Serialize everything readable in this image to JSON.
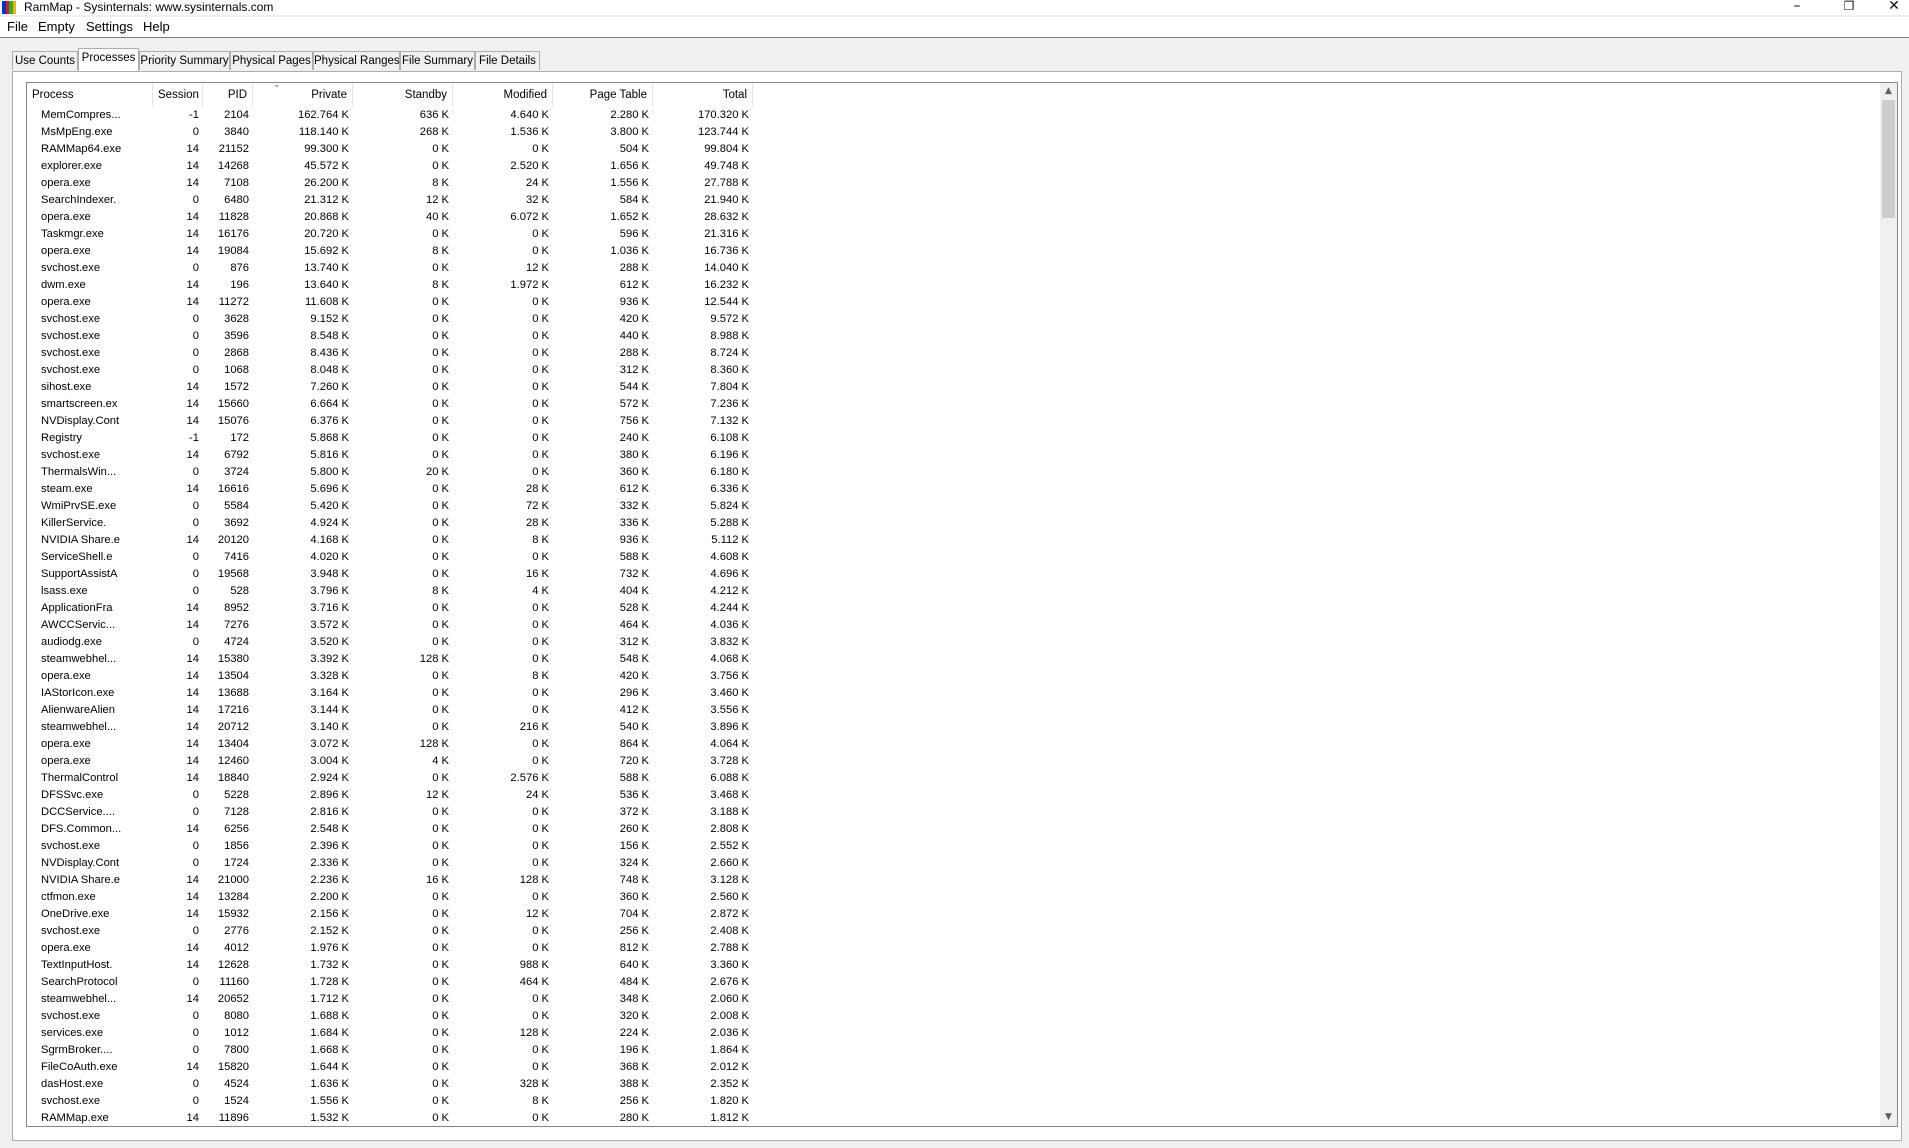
{
  "window": {
    "title": "RamMap - Sysinternals: www.sysinternals.com",
    "icon_name": "rammap-app-icon",
    "icon_colors": [
      "#0033cc",
      "#cc2020",
      "#2fae2f",
      "#f0b400"
    ],
    "minimize": "–",
    "maximize": "❐",
    "close": "✕"
  },
  "menu": [
    "File",
    "Empty",
    "Settings",
    "Help"
  ],
  "tabs": [
    {
      "label": "Use Counts",
      "active": false
    },
    {
      "label": "Processes",
      "active": true
    },
    {
      "label": "Priority Summary",
      "active": false
    },
    {
      "label": "Physical Pages",
      "active": false
    },
    {
      "label": "Physical Ranges",
      "active": false
    },
    {
      "label": "File Summary",
      "active": false
    },
    {
      "label": "File Details",
      "active": false
    }
  ],
  "table": {
    "columns": [
      "Process",
      "Session",
      "PID",
      "Private",
      "Standby",
      "Modified",
      "Page Table",
      "Total"
    ],
    "sorted_column": "Private",
    "sort_indicator": "⌄",
    "rows": [
      [
        "MemCompres...",
        "-1",
        "2104",
        "162.764 K",
        "636 K",
        "4.640 K",
        "2.280 K",
        "170.320 K"
      ],
      [
        "MsMpEng.exe",
        "0",
        "3840",
        "118.140 K",
        "268 K",
        "1.536 K",
        "3.800 K",
        "123.744 K"
      ],
      [
        "RAMMap64.exe",
        "14",
        "21152",
        "99.300 K",
        "0 K",
        "0 K",
        "504 K",
        "99.804 K"
      ],
      [
        "explorer.exe",
        "14",
        "14268",
        "45.572 K",
        "0 K",
        "2.520 K",
        "1.656 K",
        "49.748 K"
      ],
      [
        "opera.exe",
        "14",
        "7108",
        "26.200 K",
        "8 K",
        "24 K",
        "1.556 K",
        "27.788 K"
      ],
      [
        "SearchIndexer.",
        "0",
        "6480",
        "21.312 K",
        "12 K",
        "32 K",
        "584 K",
        "21.940 K"
      ],
      [
        "opera.exe",
        "14",
        "11828",
        "20.868 K",
        "40 K",
        "6.072 K",
        "1.652 K",
        "28.632 K"
      ],
      [
        "Taskmgr.exe",
        "14",
        "16176",
        "20.720 K",
        "0 K",
        "0 K",
        "596 K",
        "21.316 K"
      ],
      [
        "opera.exe",
        "14",
        "19084",
        "15.692 K",
        "8 K",
        "0 K",
        "1.036 K",
        "16.736 K"
      ],
      [
        "svchost.exe",
        "0",
        "876",
        "13.740 K",
        "0 K",
        "12 K",
        "288 K",
        "14.040 K"
      ],
      [
        "dwm.exe",
        "14",
        "196",
        "13.640 K",
        "8 K",
        "1.972 K",
        "612 K",
        "16.232 K"
      ],
      [
        "opera.exe",
        "14",
        "11272",
        "11.608 K",
        "0 K",
        "0 K",
        "936 K",
        "12.544 K"
      ],
      [
        "svchost.exe",
        "0",
        "3628",
        "9.152 K",
        "0 K",
        "0 K",
        "420 K",
        "9.572 K"
      ],
      [
        "svchost.exe",
        "0",
        "3596",
        "8.548 K",
        "0 K",
        "0 K",
        "440 K",
        "8.988 K"
      ],
      [
        "svchost.exe",
        "0",
        "2868",
        "8.436 K",
        "0 K",
        "0 K",
        "288 K",
        "8.724 K"
      ],
      [
        "svchost.exe",
        "0",
        "1068",
        "8.048 K",
        "0 K",
        "0 K",
        "312 K",
        "8.360 K"
      ],
      [
        "sihost.exe",
        "14",
        "1572",
        "7.260 K",
        "0 K",
        "0 K",
        "544 K",
        "7.804 K"
      ],
      [
        "smartscreen.ex",
        "14",
        "15660",
        "6.664 K",
        "0 K",
        "0 K",
        "572 K",
        "7.236 K"
      ],
      [
        "NVDisplay.Cont",
        "14",
        "15076",
        "6.376 K",
        "0 K",
        "0 K",
        "756 K",
        "7.132 K"
      ],
      [
        "Registry",
        "-1",
        "172",
        "5.868 K",
        "0 K",
        "0 K",
        "240 K",
        "6.108 K"
      ],
      [
        "svchost.exe",
        "14",
        "6792",
        "5.816 K",
        "0 K",
        "0 K",
        "380 K",
        "6.196 K"
      ],
      [
        "ThermalsWin...",
        "0",
        "3724",
        "5.800 K",
        "20 K",
        "0 K",
        "360 K",
        "6.180 K"
      ],
      [
        "steam.exe",
        "14",
        "16616",
        "5.696 K",
        "0 K",
        "28 K",
        "612 K",
        "6.336 K"
      ],
      [
        "WmiPrvSE.exe",
        "0",
        "5584",
        "5.420 K",
        "0 K",
        "72 K",
        "332 K",
        "5.824 K"
      ],
      [
        "KillerService.",
        "0",
        "3692",
        "4.924 K",
        "0 K",
        "28 K",
        "336 K",
        "5.288 K"
      ],
      [
        "NVIDIA Share.e",
        "14",
        "20120",
        "4.168 K",
        "0 K",
        "8 K",
        "936 K",
        "5.112 K"
      ],
      [
        "ServiceShell.e",
        "0",
        "7416",
        "4.020 K",
        "0 K",
        "0 K",
        "588 K",
        "4.608 K"
      ],
      [
        "SupportAssistA",
        "0",
        "19568",
        "3.948 K",
        "0 K",
        "16 K",
        "732 K",
        "4.696 K"
      ],
      [
        "lsass.exe",
        "0",
        "528",
        "3.796 K",
        "8 K",
        "4 K",
        "404 K",
        "4.212 K"
      ],
      [
        "ApplicationFra",
        "14",
        "8952",
        "3.716 K",
        "0 K",
        "0 K",
        "528 K",
        "4.244 K"
      ],
      [
        "AWCCServic...",
        "14",
        "7276",
        "3.572 K",
        "0 K",
        "0 K",
        "464 K",
        "4.036 K"
      ],
      [
        "audiodg.exe",
        "0",
        "4724",
        "3.520 K",
        "0 K",
        "0 K",
        "312 K",
        "3.832 K"
      ],
      [
        "steamwebhel...",
        "14",
        "15380",
        "3.392 K",
        "128 K",
        "0 K",
        "548 K",
        "4.068 K"
      ],
      [
        "opera.exe",
        "14",
        "13504",
        "3.328 K",
        "0 K",
        "8 K",
        "420 K",
        "3.756 K"
      ],
      [
        "IAStorIcon.exe",
        "14",
        "13688",
        "3.164 K",
        "0 K",
        "0 K",
        "296 K",
        "3.460 K"
      ],
      [
        "AlienwareAlien",
        "14",
        "17216",
        "3.144 K",
        "0 K",
        "0 K",
        "412 K",
        "3.556 K"
      ],
      [
        "steamwebhel...",
        "14",
        "20712",
        "3.140 K",
        "0 K",
        "216 K",
        "540 K",
        "3.896 K"
      ],
      [
        "opera.exe",
        "14",
        "13404",
        "3.072 K",
        "128 K",
        "0 K",
        "864 K",
        "4.064 K"
      ],
      [
        "opera.exe",
        "14",
        "12460",
        "3.004 K",
        "4 K",
        "0 K",
        "720 K",
        "3.728 K"
      ],
      [
        "ThermalControl",
        "14",
        "18840",
        "2.924 K",
        "0 K",
        "2.576 K",
        "588 K",
        "6.088 K"
      ],
      [
        "DFSSvc.exe",
        "0",
        "5228",
        "2.896 K",
        "12 K",
        "24 K",
        "536 K",
        "3.468 K"
      ],
      [
        "DCCService....",
        "0",
        "7128",
        "2.816 K",
        "0 K",
        "0 K",
        "372 K",
        "3.188 K"
      ],
      [
        "DFS.Common...",
        "14",
        "6256",
        "2.548 K",
        "0 K",
        "0 K",
        "260 K",
        "2.808 K"
      ],
      [
        "svchost.exe",
        "0",
        "1856",
        "2.396 K",
        "0 K",
        "0 K",
        "156 K",
        "2.552 K"
      ],
      [
        "NVDisplay.Cont",
        "0",
        "1724",
        "2.336 K",
        "0 K",
        "0 K",
        "324 K",
        "2.660 K"
      ],
      [
        "NVIDIA Share.e",
        "14",
        "21000",
        "2.236 K",
        "16 K",
        "128 K",
        "748 K",
        "3.128 K"
      ],
      [
        "ctfmon.exe",
        "14",
        "13284",
        "2.200 K",
        "0 K",
        "0 K",
        "360 K",
        "2.560 K"
      ],
      [
        "OneDrive.exe",
        "14",
        "15932",
        "2.156 K",
        "0 K",
        "12 K",
        "704 K",
        "2.872 K"
      ],
      [
        "svchost.exe",
        "0",
        "2776",
        "2.152 K",
        "0 K",
        "0 K",
        "256 K",
        "2.408 K"
      ],
      [
        "opera.exe",
        "14",
        "4012",
        "1.976 K",
        "0 K",
        "0 K",
        "812 K",
        "2.788 K"
      ],
      [
        "TextInputHost.",
        "14",
        "12628",
        "1.732 K",
        "0 K",
        "988 K",
        "640 K",
        "3.360 K"
      ],
      [
        "SearchProtocol",
        "0",
        "11160",
        "1.728 K",
        "0 K",
        "464 K",
        "484 K",
        "2.676 K"
      ],
      [
        "steamwebhel...",
        "14",
        "20652",
        "1.712 K",
        "0 K",
        "0 K",
        "348 K",
        "2.060 K"
      ],
      [
        "svchost.exe",
        "0",
        "8080",
        "1.688 K",
        "0 K",
        "0 K",
        "320 K",
        "2.008 K"
      ],
      [
        "services.exe",
        "0",
        "1012",
        "1.684 K",
        "0 K",
        "128 K",
        "224 K",
        "2.036 K"
      ],
      [
        "SgrmBroker....",
        "0",
        "7800",
        "1.668 K",
        "0 K",
        "0 K",
        "196 K",
        "1.864 K"
      ],
      [
        "FileCoAuth.exe",
        "14",
        "15820",
        "1.644 K",
        "0 K",
        "0 K",
        "368 K",
        "2.012 K"
      ],
      [
        "dasHost.exe",
        "0",
        "4524",
        "1.636 K",
        "0 K",
        "328 K",
        "388 K",
        "2.352 K"
      ],
      [
        "svchost.exe",
        "0",
        "1524",
        "1.556 K",
        "0 K",
        "8 K",
        "256 K",
        "1.820 K"
      ],
      [
        "RAMMap.exe",
        "14",
        "11896",
        "1.532 K",
        "0 K",
        "0 K",
        "280 K",
        "1.812 K"
      ]
    ]
  },
  "scrollbar": {
    "up": "▲",
    "down": "▼"
  }
}
